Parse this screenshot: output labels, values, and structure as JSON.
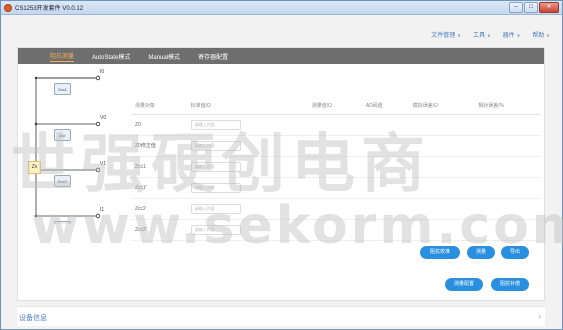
{
  "window": {
    "title": "CS1253开发套件 V0.0.12",
    "controls": {
      "minimize": "–",
      "maximize": "□",
      "close": "✕"
    }
  },
  "menubar": [
    {
      "label": "文件管理",
      "chev": "∨"
    },
    {
      "label": "工具",
      "chev": "∨"
    },
    {
      "label": "器件",
      "chev": "∨"
    },
    {
      "label": "帮助",
      "chev": "∨"
    }
  ],
  "tabs": [
    {
      "label": "阻抗测量",
      "active": true
    },
    {
      "label": "AutoState模式",
      "active": false
    },
    {
      "label": "Manual模式",
      "active": false
    },
    {
      "label": "寄存器配置",
      "active": false
    }
  ],
  "circuit": {
    "nodes": [
      "I0",
      "V0",
      "V1",
      "I1"
    ],
    "boxes": [
      "Zcc1",
      "Zcc'",
      "Zcc2'",
      "Zcc2"
    ],
    "zx": "Zx"
  },
  "table": {
    "headers": [
      "测量对象",
      "标准值/Ω",
      "测量值/Ω",
      "AD码值",
      "模拟误差/Ω",
      "相对误差/%"
    ],
    "rows": [
      {
        "label": "Z0",
        "placeholder": "请输入内容"
      },
      {
        "label": "Z0修正值",
        "placeholder": "请输入内容"
      },
      {
        "label": "Zcc1",
        "placeholder": "请输入内容"
      },
      {
        "label": "Zcc1'",
        "placeholder": "请输入内容"
      },
      {
        "label": "Zcc2",
        "placeholder": "请输入内容"
      },
      {
        "label": "Zcc2'",
        "placeholder": "请输入内容"
      }
    ]
  },
  "buttons": {
    "calibrate": "阻抗校准",
    "measure": "测量",
    "export": "导出",
    "measure_config": "测量配置",
    "compensate": "阻抗补偿"
  },
  "footer": {
    "label": "设备信息",
    "arrow": "›"
  },
  "watermark": {
    "line1": "世强硬创电商",
    "line2": "www.sekorm.com"
  },
  "colors": {
    "accent": "#2b8fe0",
    "tab_active": "#f6b05c",
    "tabbar": "#6e6e6e",
    "menu": "#4a7fbf"
  }
}
